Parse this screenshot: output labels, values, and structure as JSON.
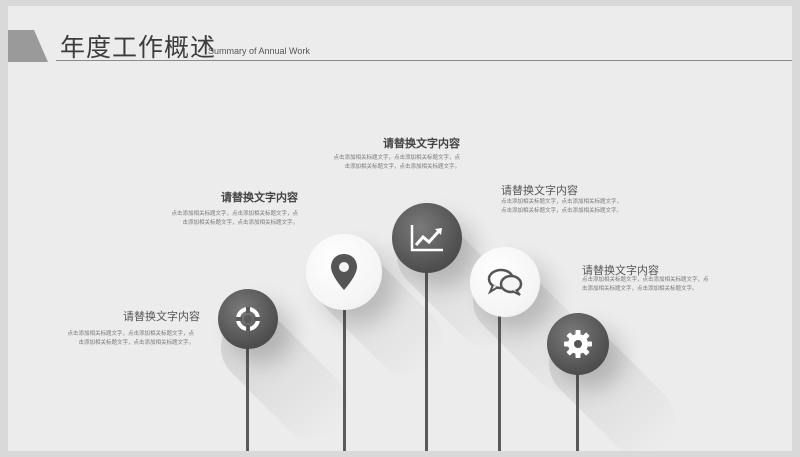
{
  "header": {
    "title": "年度工作概述",
    "subtitle": "Summary of Annual Work"
  },
  "items": [
    {
      "title": "请替换文字内容",
      "text": "点击添加相关标题文字，点击添加相关标题文字，点击添加相关标题文字，点击添加相关标题文字。",
      "icon": "lifebuoy-icon"
    },
    {
      "title": "请替换文字内容",
      "text": "点击添加相关标题文字，点击添加相关标题文字，点击添加相关标题文字，点击添加相关标题文字。",
      "icon": "map-pin-icon"
    },
    {
      "title": "请替换文字内容",
      "text": "点击添加相关标题文字，点击添加相关标题文字，点击添加相关标题文字，点击添加相关标题文字。",
      "icon": "line-chart-icon"
    },
    {
      "title": "请替换文字内容",
      "text": "点击添加相关标题文字，点击添加相关标题文字，点击添加相关标题文字，点击添加相关标题文字。",
      "icon": "chat-bubbles-icon"
    },
    {
      "title": "请替换文字内容",
      "text": "点击添加相关标题文字，点击添加相关标题文字，点击添加相关标题文字，点击添加相关标题文字。",
      "icon": "gear-icon"
    }
  ],
  "colors": {
    "background": "#ececec",
    "dark_node": "#4e4e4e",
    "light_node": "#f4f4f4",
    "stem": "#5a5a5a"
  }
}
